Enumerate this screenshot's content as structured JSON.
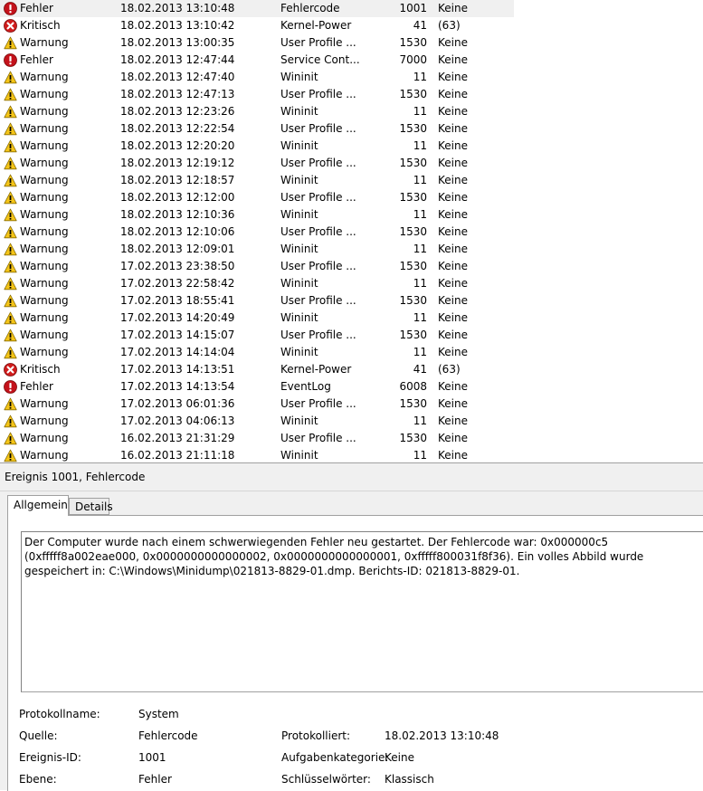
{
  "events": [
    {
      "level": "Fehler",
      "type": "error",
      "date": "18.02.2013 13:10:48",
      "source": "Fehlercode",
      "id": "1001",
      "task": "Keine"
    },
    {
      "level": "Kritisch",
      "type": "critical",
      "date": "18.02.2013 13:10:42",
      "source": "Kernel-Power",
      "id": "41",
      "task": "(63)"
    },
    {
      "level": "Warnung",
      "type": "warning",
      "date": "18.02.2013 13:00:35",
      "source": "User Profile ...",
      "id": "1530",
      "task": "Keine"
    },
    {
      "level": "Fehler",
      "type": "error",
      "date": "18.02.2013 12:47:44",
      "source": "Service Cont...",
      "id": "7000",
      "task": "Keine"
    },
    {
      "level": "Warnung",
      "type": "warning",
      "date": "18.02.2013 12:47:40",
      "source": "Wininit",
      "id": "11",
      "task": "Keine"
    },
    {
      "level": "Warnung",
      "type": "warning",
      "date": "18.02.2013 12:47:13",
      "source": "User Profile ...",
      "id": "1530",
      "task": "Keine"
    },
    {
      "level": "Warnung",
      "type": "warning",
      "date": "18.02.2013 12:23:26",
      "source": "Wininit",
      "id": "11",
      "task": "Keine"
    },
    {
      "level": "Warnung",
      "type": "warning",
      "date": "18.02.2013 12:22:54",
      "source": "User Profile ...",
      "id": "1530",
      "task": "Keine"
    },
    {
      "level": "Warnung",
      "type": "warning",
      "date": "18.02.2013 12:20:20",
      "source": "Wininit",
      "id": "11",
      "task": "Keine"
    },
    {
      "level": "Warnung",
      "type": "warning",
      "date": "18.02.2013 12:19:12",
      "source": "User Profile ...",
      "id": "1530",
      "task": "Keine"
    },
    {
      "level": "Warnung",
      "type": "warning",
      "date": "18.02.2013 12:18:57",
      "source": "Wininit",
      "id": "11",
      "task": "Keine"
    },
    {
      "level": "Warnung",
      "type": "warning",
      "date": "18.02.2013 12:12:00",
      "source": "User Profile ...",
      "id": "1530",
      "task": "Keine"
    },
    {
      "level": "Warnung",
      "type": "warning",
      "date": "18.02.2013 12:10:36",
      "source": "Wininit",
      "id": "11",
      "task": "Keine"
    },
    {
      "level": "Warnung",
      "type": "warning",
      "date": "18.02.2013 12:10:06",
      "source": "User Profile ...",
      "id": "1530",
      "task": "Keine"
    },
    {
      "level": "Warnung",
      "type": "warning",
      "date": "18.02.2013 12:09:01",
      "source": "Wininit",
      "id": "11",
      "task": "Keine"
    },
    {
      "level": "Warnung",
      "type": "warning",
      "date": "17.02.2013 23:38:50",
      "source": "User Profile ...",
      "id": "1530",
      "task": "Keine"
    },
    {
      "level": "Warnung",
      "type": "warning",
      "date": "17.02.2013 22:58:42",
      "source": "Wininit",
      "id": "11",
      "task": "Keine"
    },
    {
      "level": "Warnung",
      "type": "warning",
      "date": "17.02.2013 18:55:41",
      "source": "User Profile ...",
      "id": "1530",
      "task": "Keine"
    },
    {
      "level": "Warnung",
      "type": "warning",
      "date": "17.02.2013 14:20:49",
      "source": "Wininit",
      "id": "11",
      "task": "Keine"
    },
    {
      "level": "Warnung",
      "type": "warning",
      "date": "17.02.2013 14:15:07",
      "source": "User Profile ...",
      "id": "1530",
      "task": "Keine"
    },
    {
      "level": "Warnung",
      "type": "warning",
      "date": "17.02.2013 14:14:04",
      "source": "Wininit",
      "id": "11",
      "task": "Keine"
    },
    {
      "level": "Kritisch",
      "type": "critical",
      "date": "17.02.2013 14:13:51",
      "source": "Kernel-Power",
      "id": "41",
      "task": "(63)"
    },
    {
      "level": "Fehler",
      "type": "error",
      "date": "17.02.2013 14:13:54",
      "source": "EventLog",
      "id": "6008",
      "task": "Keine"
    },
    {
      "level": "Warnung",
      "type": "warning",
      "date": "17.02.2013 06:01:36",
      "source": "User Profile ...",
      "id": "1530",
      "task": "Keine"
    },
    {
      "level": "Warnung",
      "type": "warning",
      "date": "17.02.2013 04:06:13",
      "source": "Wininit",
      "id": "11",
      "task": "Keine"
    },
    {
      "level": "Warnung",
      "type": "warning",
      "date": "16.02.2013 21:31:29",
      "source": "User Profile ...",
      "id": "1530",
      "task": "Keine"
    },
    {
      "level": "Warnung",
      "type": "warning",
      "date": "16.02.2013 21:11:18",
      "source": "Wininit",
      "id": "11",
      "task": "Keine"
    }
  ],
  "icons": {
    "error": "error-icon",
    "critical": "critical-icon",
    "warning": "warning-icon"
  },
  "colors": {
    "error": "#c4121b",
    "critical": "#d01c1c",
    "warning": "#f5c518",
    "selected_row": "#f0f0f0",
    "pane_bg": "#f0f0f0"
  },
  "detail": {
    "title": "Ereignis 1001, Fehlercode",
    "tabs": {
      "general": "Allgemein",
      "details": "Details"
    },
    "message": "Der Computer wurde nach einem schwerwiegenden Fehler neu gestartet. Der Fehlercode war: 0x000000c5 (0xfffff8a002eae000, 0x0000000000000002, 0x0000000000000001, 0xfffff800031f8f36). Ein volles Abbild wurde gespeichert in: C:\\Windows\\Minidump\\021813-8829-01.dmp. Berichts-ID: 021813-8829-01.",
    "props": {
      "log_name_label": "Protokollname:",
      "log_name": "System",
      "source_label": "Quelle:",
      "source": "Fehlercode",
      "logged_label": "Protokolliert:",
      "logged": "18.02.2013 13:10:48",
      "event_id_label": "Ereignis-ID:",
      "event_id": "1001",
      "task_category_label": "Aufgabenkategorie:",
      "task_category": "Keine",
      "level_label": "Ebene:",
      "level": "Fehler",
      "keywords_label": "Schlüsselwörter:",
      "keywords": "Klassisch"
    }
  }
}
